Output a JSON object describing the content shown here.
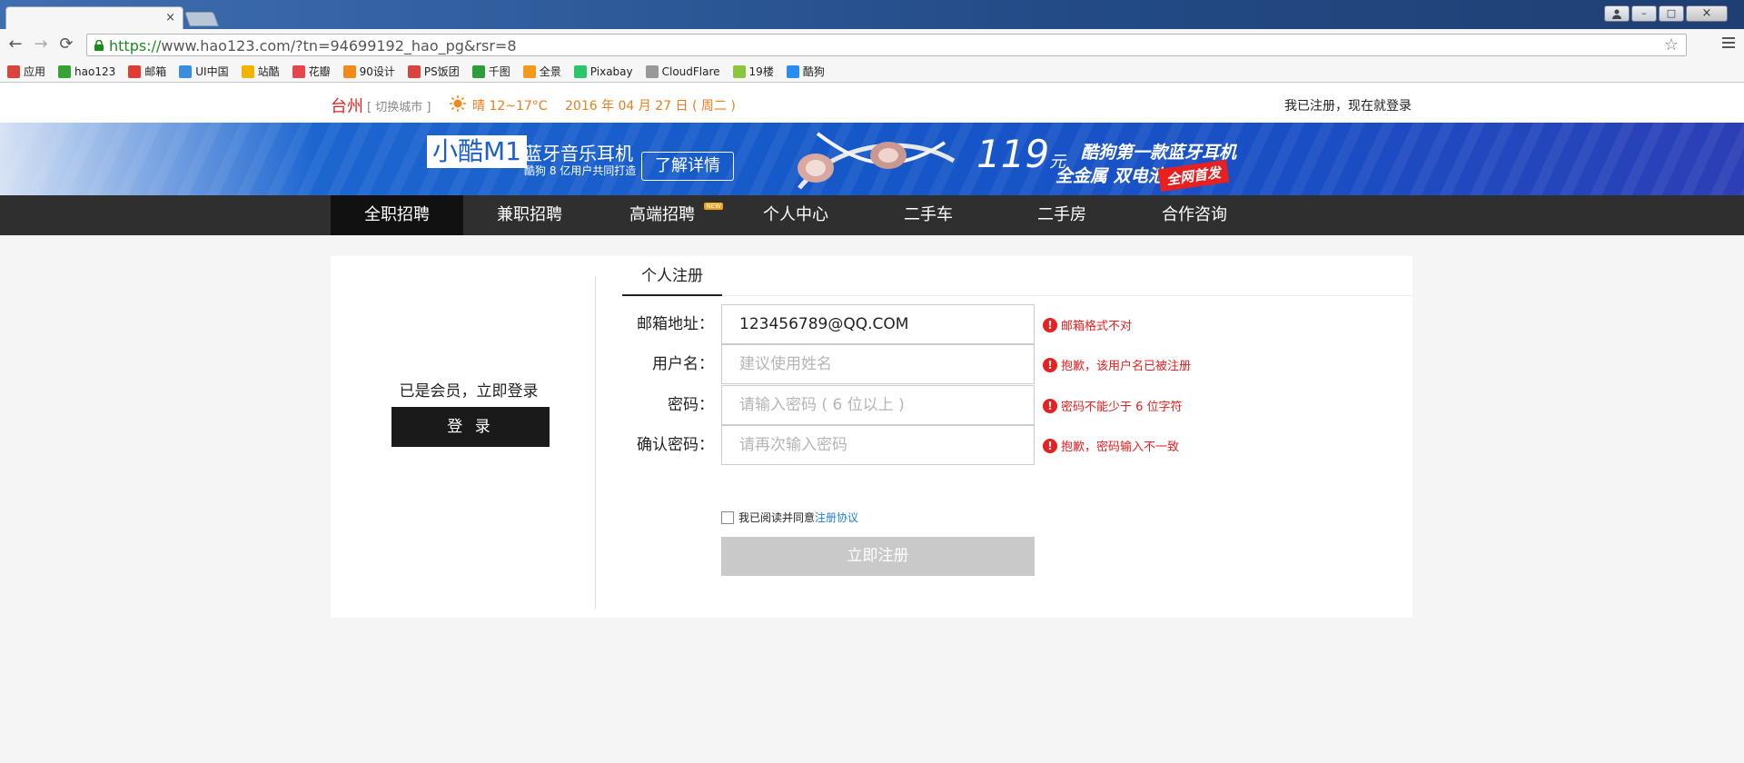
{
  "browser": {
    "tab_close": "×",
    "url_proto": "https://",
    "url_rest": "www.hao123.com/?tn=94699192_hao_pg&rsr=8",
    "window_controls": {
      "minimize": "–",
      "maximize": "□",
      "close": "×"
    }
  },
  "bookmarks": [
    {
      "label": "应用",
      "icon": "apps-icon",
      "color": "#d9453d"
    },
    {
      "label": "hao123",
      "icon": "hao123-icon",
      "color": "#37a336"
    },
    {
      "label": "邮箱",
      "icon": "mail-icon",
      "color": "#e03c31"
    },
    {
      "label": "UI中国",
      "icon": "ui-china-icon",
      "color": "#3a8de0"
    },
    {
      "label": "站酷",
      "icon": "zcool-icon",
      "color": "#f0b400"
    },
    {
      "label": "花瓣",
      "icon": "huaban-icon",
      "color": "#e5474f"
    },
    {
      "label": "90设计",
      "icon": "90design-icon",
      "color": "#f08a1c"
    },
    {
      "label": "PS饭团",
      "icon": "psfantuan-icon",
      "color": "#d9453d"
    },
    {
      "label": "千图",
      "icon": "qiantu-icon",
      "color": "#2e9c3a"
    },
    {
      "label": "全景",
      "icon": "quanjing-icon",
      "color": "#f39a1e"
    },
    {
      "label": "Pixabay",
      "icon": "pixabay-icon",
      "color": "#2ec66d"
    },
    {
      "label": "CloudFlare",
      "icon": "page-icon",
      "color": "#999999"
    },
    {
      "label": "19楼",
      "icon": "19lou-icon",
      "color": "#8cc63f"
    },
    {
      "label": "酷狗",
      "icon": "kugou-icon",
      "color": "#2b8df0"
    }
  ],
  "topinfo": {
    "city": "台州",
    "switch_city": "[ 切换城市 ]",
    "weather": "晴  12~17°C",
    "date": "2016 年 04 月 27 日 ( 周二 )",
    "login_link": "我已注册，现在就登录"
  },
  "banner": {
    "brand": "小酷M1",
    "title": "蓝牙音乐耳机",
    "subtitle": "酷狗 8 亿用户共同打造",
    "cta": "了解详情",
    "price": "119",
    "price_unit": "元",
    "tag1": "酷狗第一款蓝牙耳机",
    "tag2": "全金属 双电池",
    "badge": "全网首发"
  },
  "nav": {
    "items": [
      {
        "label": "全职招聘"
      },
      {
        "label": "兼职招聘"
      },
      {
        "label": "高端招聘",
        "badge": "NEW"
      },
      {
        "label": "个人中心"
      },
      {
        "label": "二手车"
      },
      {
        "label": "二手房"
      },
      {
        "label": "合作咨询"
      }
    ]
  },
  "login_panel": {
    "member_text": "已是会员，立即登录",
    "login_button": "登 录"
  },
  "register": {
    "tab": "个人注册",
    "fields": [
      {
        "label": "邮箱地址：",
        "value": "123456789@QQ.COM",
        "placeholder": "",
        "error": "邮箱格式不对"
      },
      {
        "label": "用户名：",
        "value": "",
        "placeholder": "建议使用姓名",
        "error": "抱歉，该用户名已被注册"
      },
      {
        "label": "密码：",
        "value": "",
        "placeholder": "请输入密码 ( 6 位以上 )",
        "error": "密码不能少于 6 位字符"
      },
      {
        "label": "确认密码：",
        "value": "",
        "placeholder": "请再次输入密码",
        "error": "抱歉，密码输入不一致"
      }
    ],
    "agree_text": "我已阅读并同意",
    "agree_link": "注册协议",
    "submit": "立即注册"
  },
  "colors": {
    "accent_red": "#e8201f",
    "weather_orange": "#e87e1e",
    "nav_bg": "#2f2f2f",
    "link_blue": "#1e7fd8"
  }
}
